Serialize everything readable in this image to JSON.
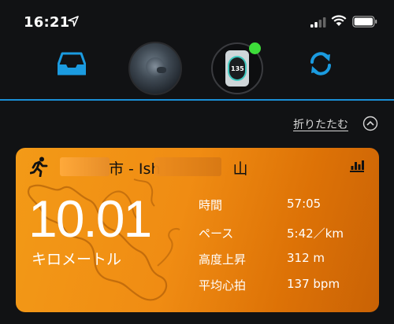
{
  "status_bar": {
    "time": "16:21"
  },
  "header": {
    "collapse_label": "折りたたむ",
    "device_face_value": "135"
  },
  "activity": {
    "title_visible_part_1": "市 - Ish",
    "title_visible_part_2": "山",
    "distance": "10.01",
    "distance_unit": "キロメートル",
    "stats": [
      {
        "label": "時間",
        "value": "57:05"
      },
      {
        "label": "ペース",
        "value": "5:42／km"
      },
      {
        "label": "高度上昇",
        "value": "312 m"
      },
      {
        "label": "平均心拍",
        "value": "137 bpm"
      }
    ]
  },
  "colors": {
    "background": "#111214",
    "accent_blue": "#1a8fd6",
    "card_orange": "#f39a17",
    "status_green": "#3ddc3a"
  }
}
